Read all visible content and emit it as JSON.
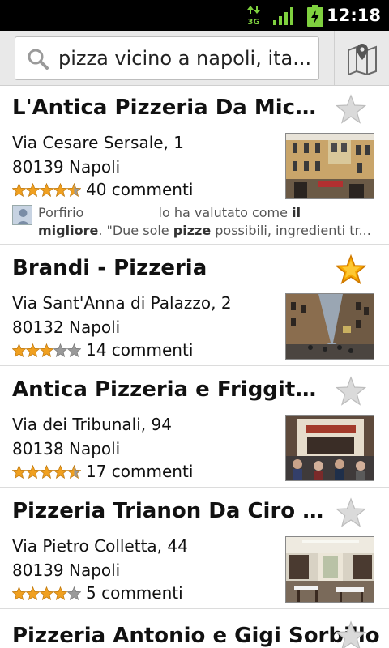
{
  "status_bar": {
    "time": "12:18",
    "network_label": "3G",
    "icons": [
      "data-3g-icon",
      "signal-icon",
      "battery-charging-icon"
    ]
  },
  "search": {
    "query": "pizza vicino a napoli, ita..."
  },
  "results": [
    {
      "name": "L'Antica Pizzeria Da Michele",
      "address_line1": "Via Cesare Sersale, 1",
      "address_line2": "80139 Napoli",
      "rating": 4.5,
      "reviews": "40 commenti",
      "starred": false,
      "review_snippet": {
        "author": "Porfirio",
        "line1_text": "lo ha valutato come",
        "line1_bold": "il",
        "line2_bold1": "migliore",
        "line2_text1": ". \"Due sole",
        "line2_bold2": "pizze",
        "line2_text2": "possibili, ingredienti tr..."
      }
    },
    {
      "name": "Brandi - Pizzeria",
      "address_line1": "Via Sant'Anna di Palazzo, 2",
      "address_line2": "80132 Napoli",
      "rating": 3,
      "reviews": "14 commenti",
      "starred": true
    },
    {
      "name": "Antica Pizzeria e Friggitoria",
      "address_line1": "Via dei Tribunali, 94",
      "address_line2": "80138 Napoli",
      "rating": 4.5,
      "reviews": "17 commenti",
      "starred": false
    },
    {
      "name": "Pizzeria Trianon Da Ciro Di Le...",
      "address_line1": "Via Pietro Colletta, 44",
      "address_line2": "80139 Napoli",
      "rating": 4,
      "reviews": "5 commenti",
      "starred": false
    },
    {
      "name": "Pizzeria Antonio e Gigi Sorbillo",
      "starred": false
    }
  ],
  "colors": {
    "star_filled": "#f0a020",
    "star_empty": "#9a9a9a",
    "favorite_star": "#f7a800"
  }
}
